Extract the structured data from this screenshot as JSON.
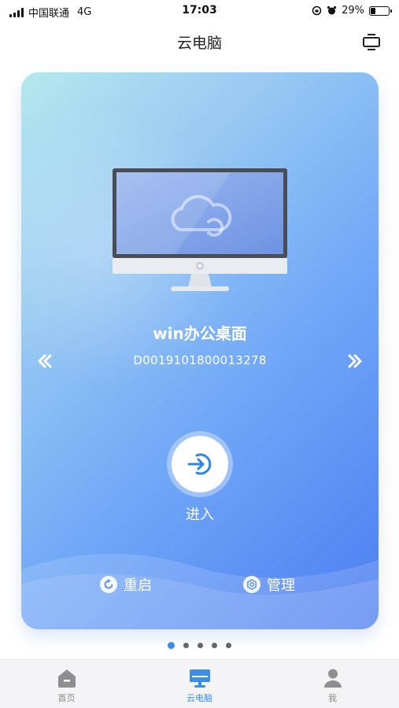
{
  "status_bar": {
    "carrier": "中国联通",
    "network": "4G",
    "time": "17:03",
    "battery": "29%",
    "battery_level": 0.29
  },
  "nav": {
    "title": "云电脑",
    "action_icon": "switch-screen-icon"
  },
  "card": {
    "desktop_name": "win办公桌面",
    "desktop_id": "D0019101800013278",
    "enter_label": "进入",
    "restart_label": "重启",
    "manage_label": "管理",
    "accent_color": "#3b8ee6"
  },
  "pager": {
    "total": 5,
    "active_index": 0
  },
  "tabs": [
    {
      "label": "首页",
      "icon": "home-icon",
      "active": false
    },
    {
      "label": "云电脑",
      "icon": "monitor-icon",
      "active": true
    },
    {
      "label": "我",
      "icon": "person-icon",
      "active": false
    }
  ]
}
